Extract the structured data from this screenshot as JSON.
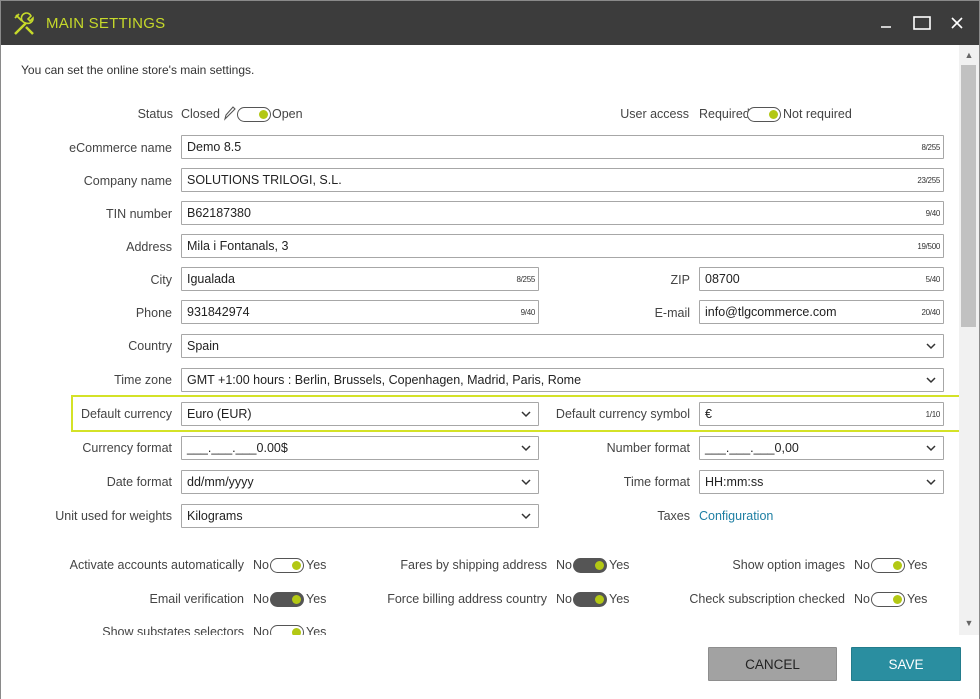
{
  "window": {
    "title": "MAIN SETTINGS",
    "accent": "#c6d92a",
    "controls": {
      "minimize": "minimize-icon",
      "maximize": "maximize-icon",
      "close": "close-icon"
    }
  },
  "intro": "You can set the online store's main settings.",
  "status": {
    "label": "Status",
    "off_text": "Closed",
    "on_text": "Open",
    "value": "Open"
  },
  "user_access": {
    "label": "User access",
    "off_text": "Required",
    "on_text": "Not required",
    "value": "Not required"
  },
  "fields": {
    "ecommerce_name": {
      "label": "eCommerce name",
      "value": "Demo 8.5",
      "counter": "8/255"
    },
    "company_name": {
      "label": "Company name",
      "value": "SOLUTIONS TRILOGI, S.L.",
      "counter": "23/255"
    },
    "tin_number": {
      "label": "TIN number",
      "value": "B62187380",
      "counter": "9/40"
    },
    "address": {
      "label": "Address",
      "value": "Mila i Fontanals, 3",
      "counter": "19/500"
    },
    "city": {
      "label": "City",
      "value": "Igualada",
      "counter": "8/255"
    },
    "zip": {
      "label": "ZIP",
      "value": "08700",
      "counter": "5/40"
    },
    "phone": {
      "label": "Phone",
      "value": "931842974",
      "counter": "9/40"
    },
    "email": {
      "label": "E-mail",
      "value": "info@tlgcommerce.com",
      "counter": "20/40"
    },
    "country": {
      "label": "Country",
      "value": "Spain"
    },
    "time_zone": {
      "label": "Time zone",
      "value": "GMT +1:00 hours : Berlin, Brussels, Copenhagen, Madrid, Paris, Rome"
    },
    "default_currency": {
      "label": "Default currency",
      "value": "Euro (EUR)"
    },
    "default_currency_symbol": {
      "label": "Default currency symbol",
      "value": "€",
      "counter": "1/10"
    },
    "currency_format": {
      "label": "Currency format",
      "value": "___.___.___0.00$"
    },
    "number_format": {
      "label": "Number format",
      "value": "___.___.___0,00"
    },
    "date_format": {
      "label": "Date format",
      "value": "dd/mm/yyyy"
    },
    "time_format": {
      "label": "Time format",
      "value": "HH:mm:ss"
    },
    "weight_unit": {
      "label": "Unit used for weights",
      "value": "Kilograms"
    },
    "taxes": {
      "label": "Taxes",
      "link": "Configuration"
    }
  },
  "toggles": {
    "no": "No",
    "yes": "Yes",
    "activate_accounts": {
      "label": "Activate accounts automatically",
      "value": "Yes"
    },
    "fares_by_shipping": {
      "label": "Fares by shipping address",
      "value": "Yes"
    },
    "show_option_images": {
      "label": "Show option images",
      "value": "Yes"
    },
    "email_verification": {
      "label": "Email verification",
      "value": "Yes"
    },
    "force_billing_country": {
      "label": "Force billing address country",
      "value": "Yes"
    },
    "check_subscription": {
      "label": "Check subscription checked",
      "value": "Yes"
    },
    "show_substates": {
      "label": "Show substates selectors",
      "value": "Yes"
    }
  },
  "footer": {
    "cancel": "CANCEL",
    "save": "SAVE"
  },
  "colors": {
    "primary_button": "#2a8ea0",
    "secondary_button": "#a2a2a2",
    "highlight": "#d4e227",
    "link": "#1e7fa3"
  }
}
